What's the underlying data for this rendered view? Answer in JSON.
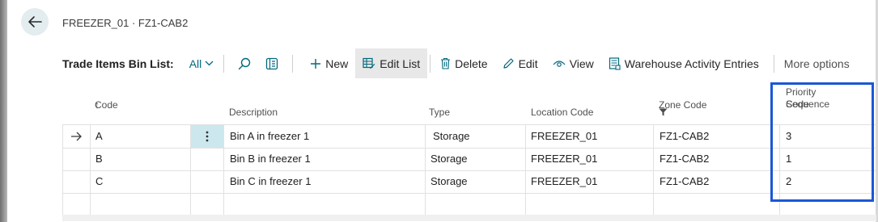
{
  "breadcrumb": "FREEZER_01 · FZ1-CAB2",
  "toolbar": {
    "list_title": "Trade Items Bin List:",
    "view": "All",
    "new_label": "New",
    "edit_list_label": "Edit List",
    "delete_label": "Delete",
    "edit_label": "Edit",
    "view_label": "View",
    "warehouse_label": "Warehouse Activity Entries",
    "more_label": "More options"
  },
  "columns": {
    "code": "Code",
    "code_sort_indicator": "↑",
    "description": "Description",
    "type": "Type",
    "location": "Location Code",
    "zone": "Zone Code",
    "priority_line1": "Priority Sequence",
    "priority_line2": "Code"
  },
  "rows": [
    {
      "code": "A",
      "description": "Bin A in freezer 1",
      "type": "Storage",
      "location": "FREEZER_01",
      "zone": "FZ1-CAB2",
      "priority": "3"
    },
    {
      "code": "B",
      "description": "Bin B in freezer 1",
      "type": "Storage",
      "location": "FREEZER_01",
      "zone": "FZ1-CAB2",
      "priority": "1"
    },
    {
      "code": "C",
      "description": "Bin C in freezer 1",
      "type": "Storage",
      "location": "FREEZER_01",
      "zone": "FZ1-CAB2",
      "priority": "2"
    }
  ],
  "selected_row_index": 0,
  "highlight_color": "#1b57d6",
  "accent_color": "#00687d",
  "icons": {
    "back": "back-arrow-icon",
    "search": "search-icon",
    "filter_pane": "filter-pane-icon",
    "new": "plus-icon",
    "edit_list": "edit-list-icon",
    "delete": "trash-icon",
    "edit": "pencil-icon",
    "view": "eye-icon",
    "warehouse": "warehouse-entries-icon",
    "zone_filter": "filter-funnel-icon",
    "row_pointer": "row-arrow-icon",
    "row_menu": "more-vertical-icon"
  }
}
